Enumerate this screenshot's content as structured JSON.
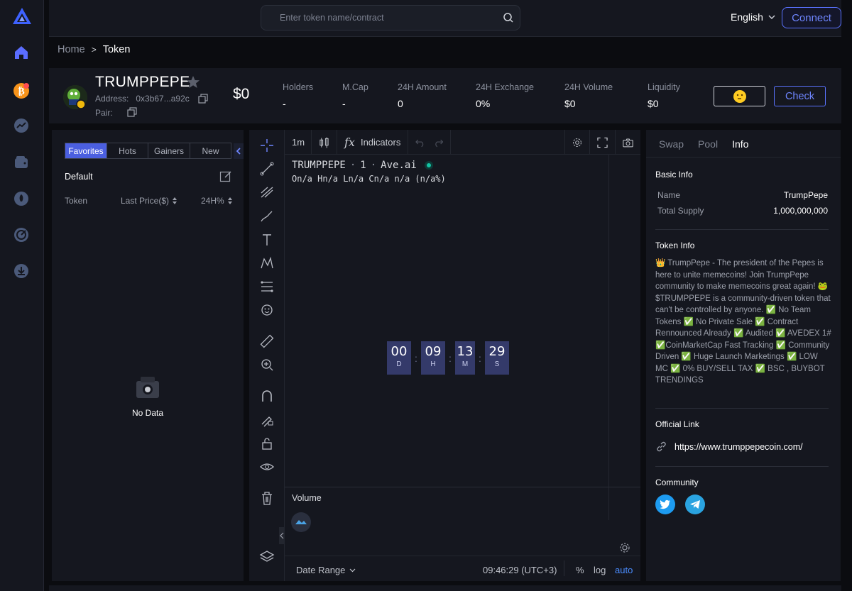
{
  "topbar": {
    "search_placeholder": "Enter token name/contract",
    "language": "English",
    "connect_label": "Connect"
  },
  "breadcrumb": {
    "home": "Home",
    "current": "Token"
  },
  "token": {
    "name": "TRUMPPEPE",
    "address_label": "Address:",
    "address": "0x3b67...a92c",
    "pair_label": "Pair:",
    "price": "$0",
    "stats": [
      {
        "label": "Holders",
        "value": "-"
      },
      {
        "label": "M.Cap",
        "value": "-"
      },
      {
        "label": "24H Amount",
        "value": "0"
      },
      {
        "label": "24H Exchange",
        "value": "0%"
      },
      {
        "label": "24H Volume",
        "value": "$0"
      },
      {
        "label": "Liquidity",
        "value": "$0"
      }
    ],
    "check_label": "Check"
  },
  "favorites": {
    "tabs": [
      "Favorites",
      "Hots",
      "Gainers",
      "New"
    ],
    "group": "Default",
    "columns": [
      "Token",
      "Last Price($)",
      "24H%"
    ],
    "empty": "No Data"
  },
  "chart": {
    "interval": "1m",
    "indicators_label": "Indicators",
    "legend_title": "TRUMPPEPE",
    "legend_sep1": "·",
    "legend_interval": "1",
    "legend_sep2": "·",
    "legend_source": "Ave.ai",
    "ohlc": "On/a Hn/a Ln/a Cn/a n/a (n/a%)",
    "countdown": {
      "days": "00",
      "hours": "09",
      "minutes": "13",
      "seconds": "29",
      "d": "D",
      "h": "H",
      "m": "M",
      "s": "S"
    },
    "volume_label": "Volume",
    "date_range": "Date Range",
    "time": "09:46:29 (UTC+3)",
    "percent": "%",
    "log": "log",
    "auto": "auto"
  },
  "info": {
    "tabs": [
      "Swap",
      "Pool",
      "Info"
    ],
    "basic_title": "Basic Info",
    "name_label": "Name",
    "name_value": "TrumpPepe",
    "supply_label": "Total Supply",
    "supply_value": "1,000,000,000",
    "token_info_title": "Token Info",
    "description": "👑 TrumpPepe - The president of the Pepes is here to unite memecoins! Join TrumpPepe community to make memecoins great again! 🐸 $TRUMPPEPE is a community-driven token that can't be controlled by anyone. ✅ No Team Tokens ✅ No Private Sale ✅ Contract Rennounced Already ✅ Audited ✅ AVEDEX 1# ✅CoinMarketCap Fast Tracking ✅ Community Driven ✅ Huge Launch Marketings ✅ LOW MC ✅ 0% BUY/SELL TAX ✅ BSC , BUYBOT TRENDINGS",
    "official_title": "Official Link",
    "official_url": "https://www.trumppepecoin.com/",
    "community_title": "Community"
  },
  "colors": {
    "accent": "#5a73ff",
    "bg": "#0b0c10",
    "panel": "#15171f",
    "countdown": "#343a6a"
  }
}
